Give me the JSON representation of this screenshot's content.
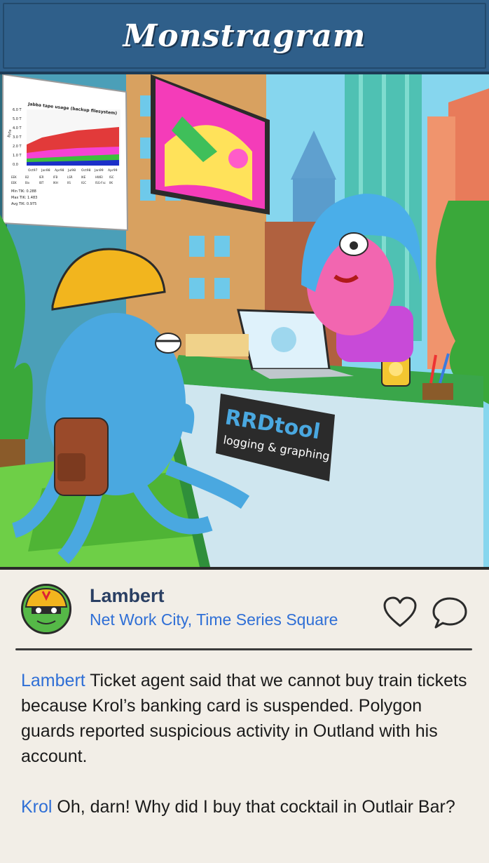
{
  "app": {
    "title": "Monstragram"
  },
  "scene": {
    "chart_poster": {
      "title": "Jabba tape usage (backup filesystem)",
      "y_axis_unit": "Byte",
      "y_ticks": [
        "6.0 T",
        "5.0 T",
        "4.0 T",
        "3.0 T",
        "2.0 T",
        "1.0 T",
        "0.0"
      ],
      "x_ticks": [
        "Oct97",
        "Jan98",
        "Apr98",
        "Jul98",
        "Oct98",
        "Jan99",
        "Apr99"
      ],
      "legend": [
        "EEK",
        "B2",
        "IER",
        "IFB",
        "LSR",
        "IKE",
        "HWEI",
        "ISC",
        "EEK",
        "Biv",
        "IBT",
        "IKH",
        "IIS",
        "IGC",
        "ISG-Fsc",
        "IIK"
      ],
      "stats": [
        {
          "label": "Min TIK:",
          "value": "0.288"
        },
        {
          "label": "Max TIK:",
          "value": "1.483"
        },
        {
          "label": "Avg TIK:",
          "value": "0.975"
        }
      ]
    },
    "desk_sign": {
      "title": "RRDtool",
      "subtitle": "logging & graphing"
    }
  },
  "post": {
    "username": "Lambert",
    "location": "Net Work City, Time Series Square",
    "comments": [
      {
        "author": "Lambert",
        "text": " Ticket agent said that we cannot buy train tickets because Krol’s banking card is suspended. Polygon guards reported suspicious activity in Outland with his account."
      },
      {
        "author": "Krol",
        "text": " Oh, darn! Why did I buy that cocktail in Outlair Bar?"
      }
    ],
    "icons": {
      "like": "heart-icon",
      "comment": "speech-bubble-icon"
    }
  },
  "colors": {
    "header": "#2f5f8a",
    "author_link": "#2f6fd6",
    "username": "#2a3f63",
    "panel": "#f2eee7"
  }
}
